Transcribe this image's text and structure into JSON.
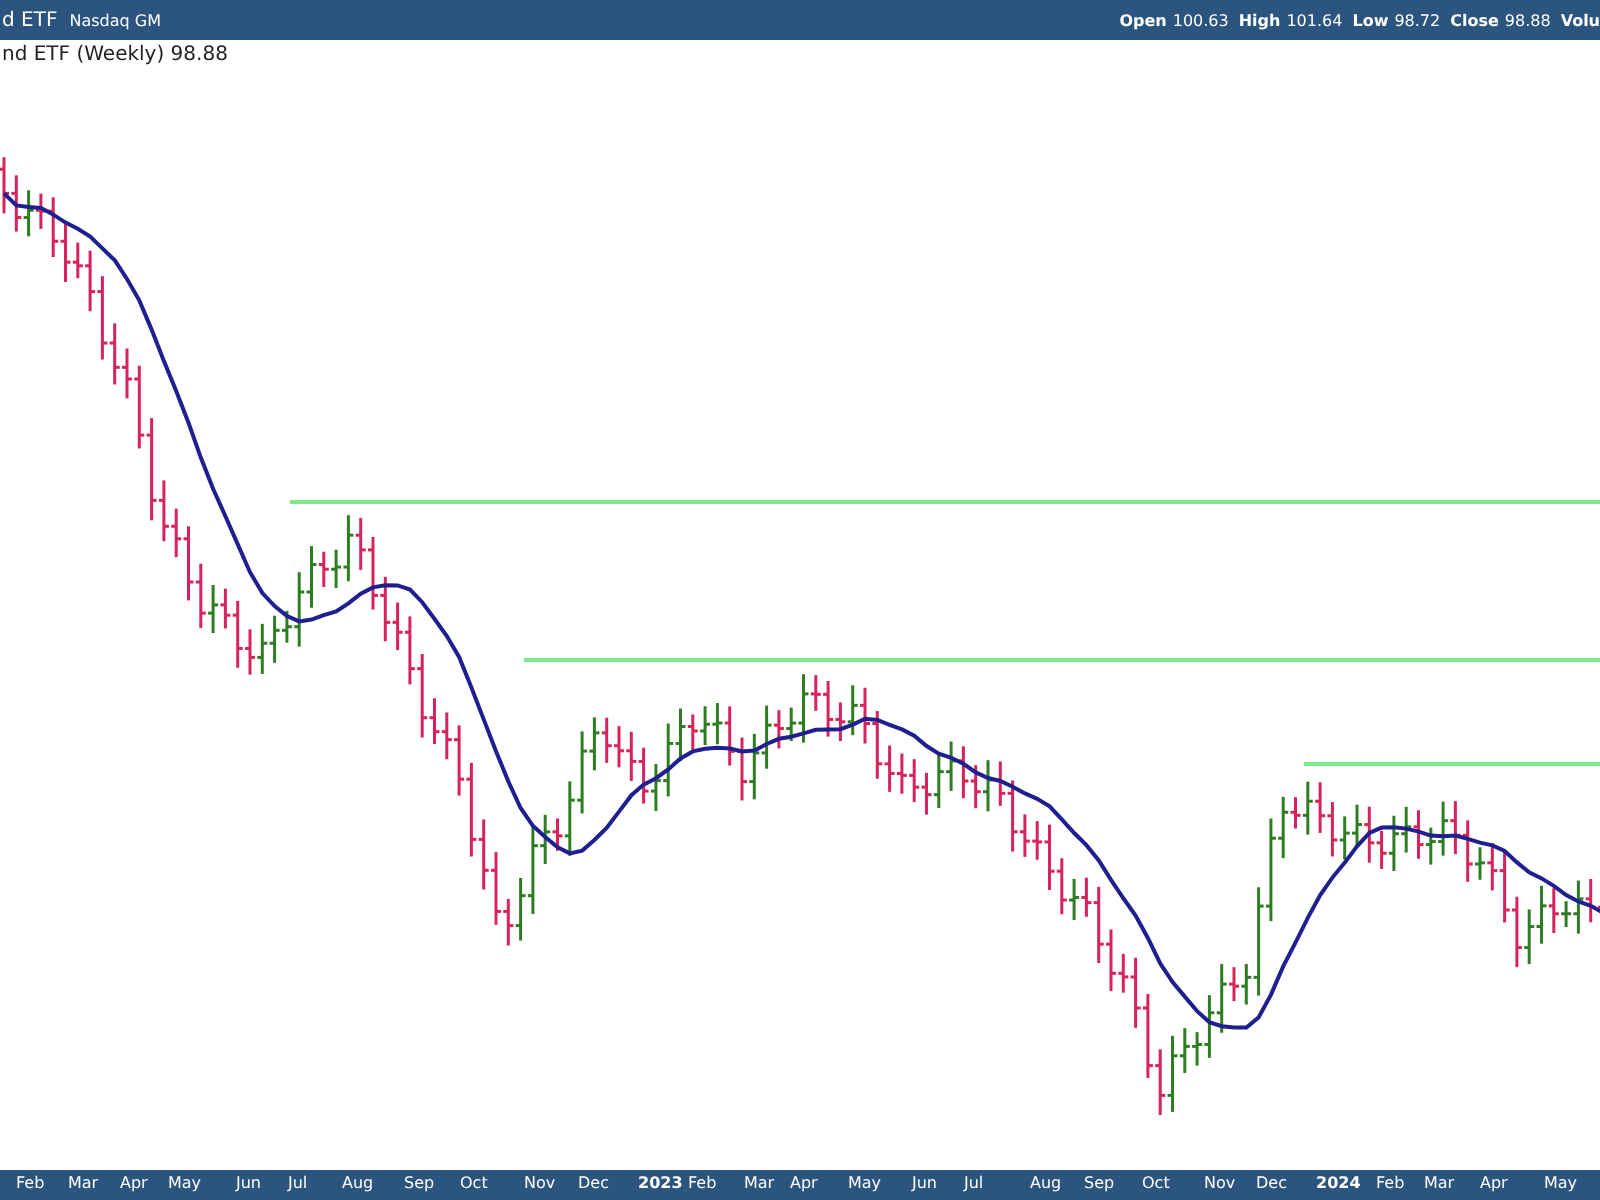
{
  "header": {
    "title": "d ETF",
    "exchange": "Nasdaq GM",
    "stats": [
      {
        "label": "Open",
        "value": "100.63"
      },
      {
        "label": "High",
        "value": "101.64"
      },
      {
        "label": "Low",
        "value": "98.72"
      },
      {
        "label": "Close",
        "value": "98.88"
      },
      {
        "label": "Volu"
      }
    ]
  },
  "legend": "nd ETF (Weekly) 98.88",
  "time_axis": [
    {
      "label": "Feb",
      "kind": "month"
    },
    {
      "label": "Mar",
      "kind": "month"
    },
    {
      "label": "Apr",
      "kind": "month"
    },
    {
      "label": "May",
      "kind": "month"
    },
    {
      "label": "Jun",
      "kind": "month"
    },
    {
      "label": "Jul",
      "kind": "month"
    },
    {
      "label": "Aug",
      "kind": "month"
    },
    {
      "label": "Sep",
      "kind": "month"
    },
    {
      "label": "Oct",
      "kind": "month"
    },
    {
      "label": "Nov",
      "kind": "month"
    },
    {
      "label": "Dec",
      "kind": "month"
    },
    {
      "label": "2023",
      "kind": "year"
    },
    {
      "label": "Feb",
      "kind": "month"
    },
    {
      "label": "Mar",
      "kind": "month"
    },
    {
      "label": "Apr",
      "kind": "month"
    },
    {
      "label": "May",
      "kind": "month"
    },
    {
      "label": "Jun",
      "kind": "month"
    },
    {
      "label": "Jul",
      "kind": "month"
    },
    {
      "label": "Aug",
      "kind": "month"
    },
    {
      "label": "Sep",
      "kind": "month"
    },
    {
      "label": "Oct",
      "kind": "month"
    },
    {
      "label": "Nov",
      "kind": "month"
    },
    {
      "label": "Dec",
      "kind": "month"
    },
    {
      "label": "2024",
      "kind": "year"
    },
    {
      "label": "Feb",
      "kind": "month"
    },
    {
      "label": "Mar",
      "kind": "month"
    },
    {
      "label": "Apr",
      "kind": "month"
    },
    {
      "label": "May",
      "kind": "month"
    }
  ]
}
